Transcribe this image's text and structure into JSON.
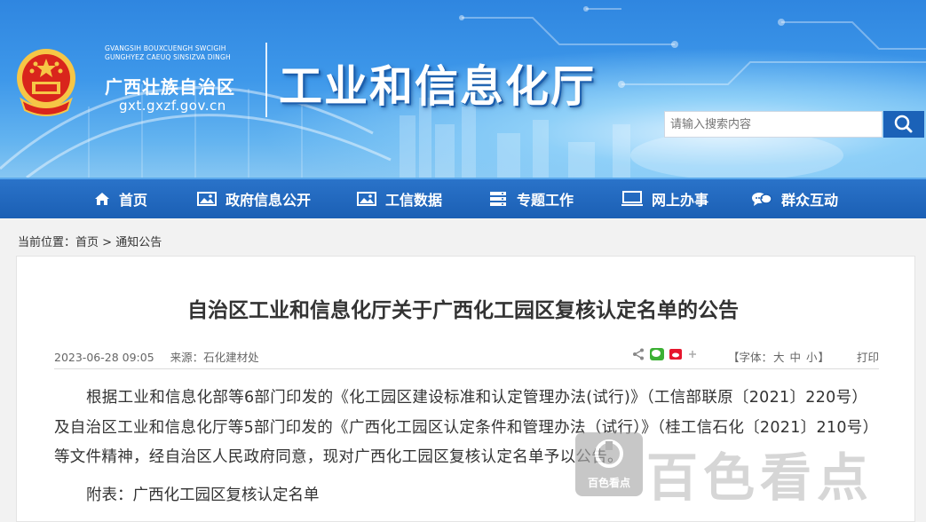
{
  "header": {
    "minority_line1": "GVANGSIH BOUXCUENGH SWCIGIH",
    "minority_line2": "GUNGHYEZ CAEUQ SINSIZVA DINGH",
    "region_name": "广西壮族自治区",
    "domain": "gxt.gxzf.gov.cn",
    "dept_name": "工业和信息化厅"
  },
  "search": {
    "placeholder": "请输入搜索内容",
    "icon": "magnifier-icon"
  },
  "nav": {
    "items": [
      {
        "label": "首页",
        "icon": "home-icon"
      },
      {
        "label": "政府信息公开",
        "icon": "image-icon"
      },
      {
        "label": "工信数据",
        "icon": "image-icon"
      },
      {
        "label": "专题工作",
        "icon": "server-icon"
      },
      {
        "label": "网上办事",
        "icon": "monitor-icon"
      },
      {
        "label": "群众互动",
        "icon": "chat-icon"
      }
    ]
  },
  "breadcrumb": {
    "prefix": "当前位置：",
    "home": "首页",
    "sep": " > ",
    "current": "通知公告"
  },
  "article": {
    "title": "自治区工业和信息化厅关于广西化工园区复核认定名单的公告",
    "date": "2023-06-28 09:05",
    "source": "来源：石化建材处",
    "font_label_open": "【字体：",
    "font_big": "大",
    "font_mid": "中",
    "font_small": "小",
    "font_label_close": "】",
    "print": "打印",
    "paragraph": "根据工业和信息化部等6部门印发的《化工园区建设标准和认定管理办法(试行)》（工信部联原〔2021〕220号）及自治区工业和信息化厅等5部门印发的《广西化工园区认定条件和管理办法（试行）》（桂工信石化〔2021〕210号）等文件精神，经自治区人民政府同意，现对广西化工园区复核认定名单予以公告。",
    "attachment": "附表：广西化工园区复核认定名单"
  },
  "watermark": {
    "small": "百色看点",
    "big": "百色看点"
  },
  "colors": {
    "nav_bg": "#1b5fb4",
    "banner_bg": "#3e98ea",
    "search_btn": "#1b62b8"
  }
}
